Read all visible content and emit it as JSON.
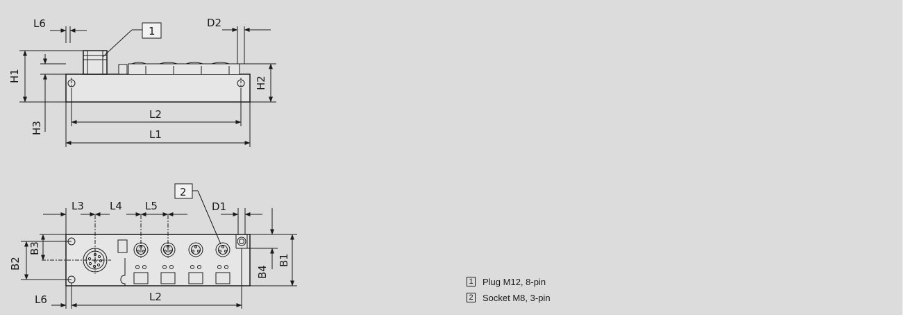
{
  "top_view": {
    "labels": {
      "L6": "L6",
      "D2": "D2",
      "H1": "H1",
      "H2": "H2",
      "H3": "H3",
      "L2": "L2",
      "L1": "L1"
    },
    "callout": "1"
  },
  "front_view": {
    "labels": {
      "L3": "L3",
      "L4": "L4",
      "L5": "L5",
      "D1": "D1",
      "B3": "B3",
      "B2": "B2",
      "B4": "B4",
      "B1": "B1",
      "L6": "L6",
      "L2": "L2"
    },
    "callout": "2"
  },
  "legend": {
    "items": [
      {
        "num": "1",
        "text": "Plug M12, 8-pin"
      },
      {
        "num": "2",
        "text": "Socket M8, 3-pin"
      }
    ]
  }
}
